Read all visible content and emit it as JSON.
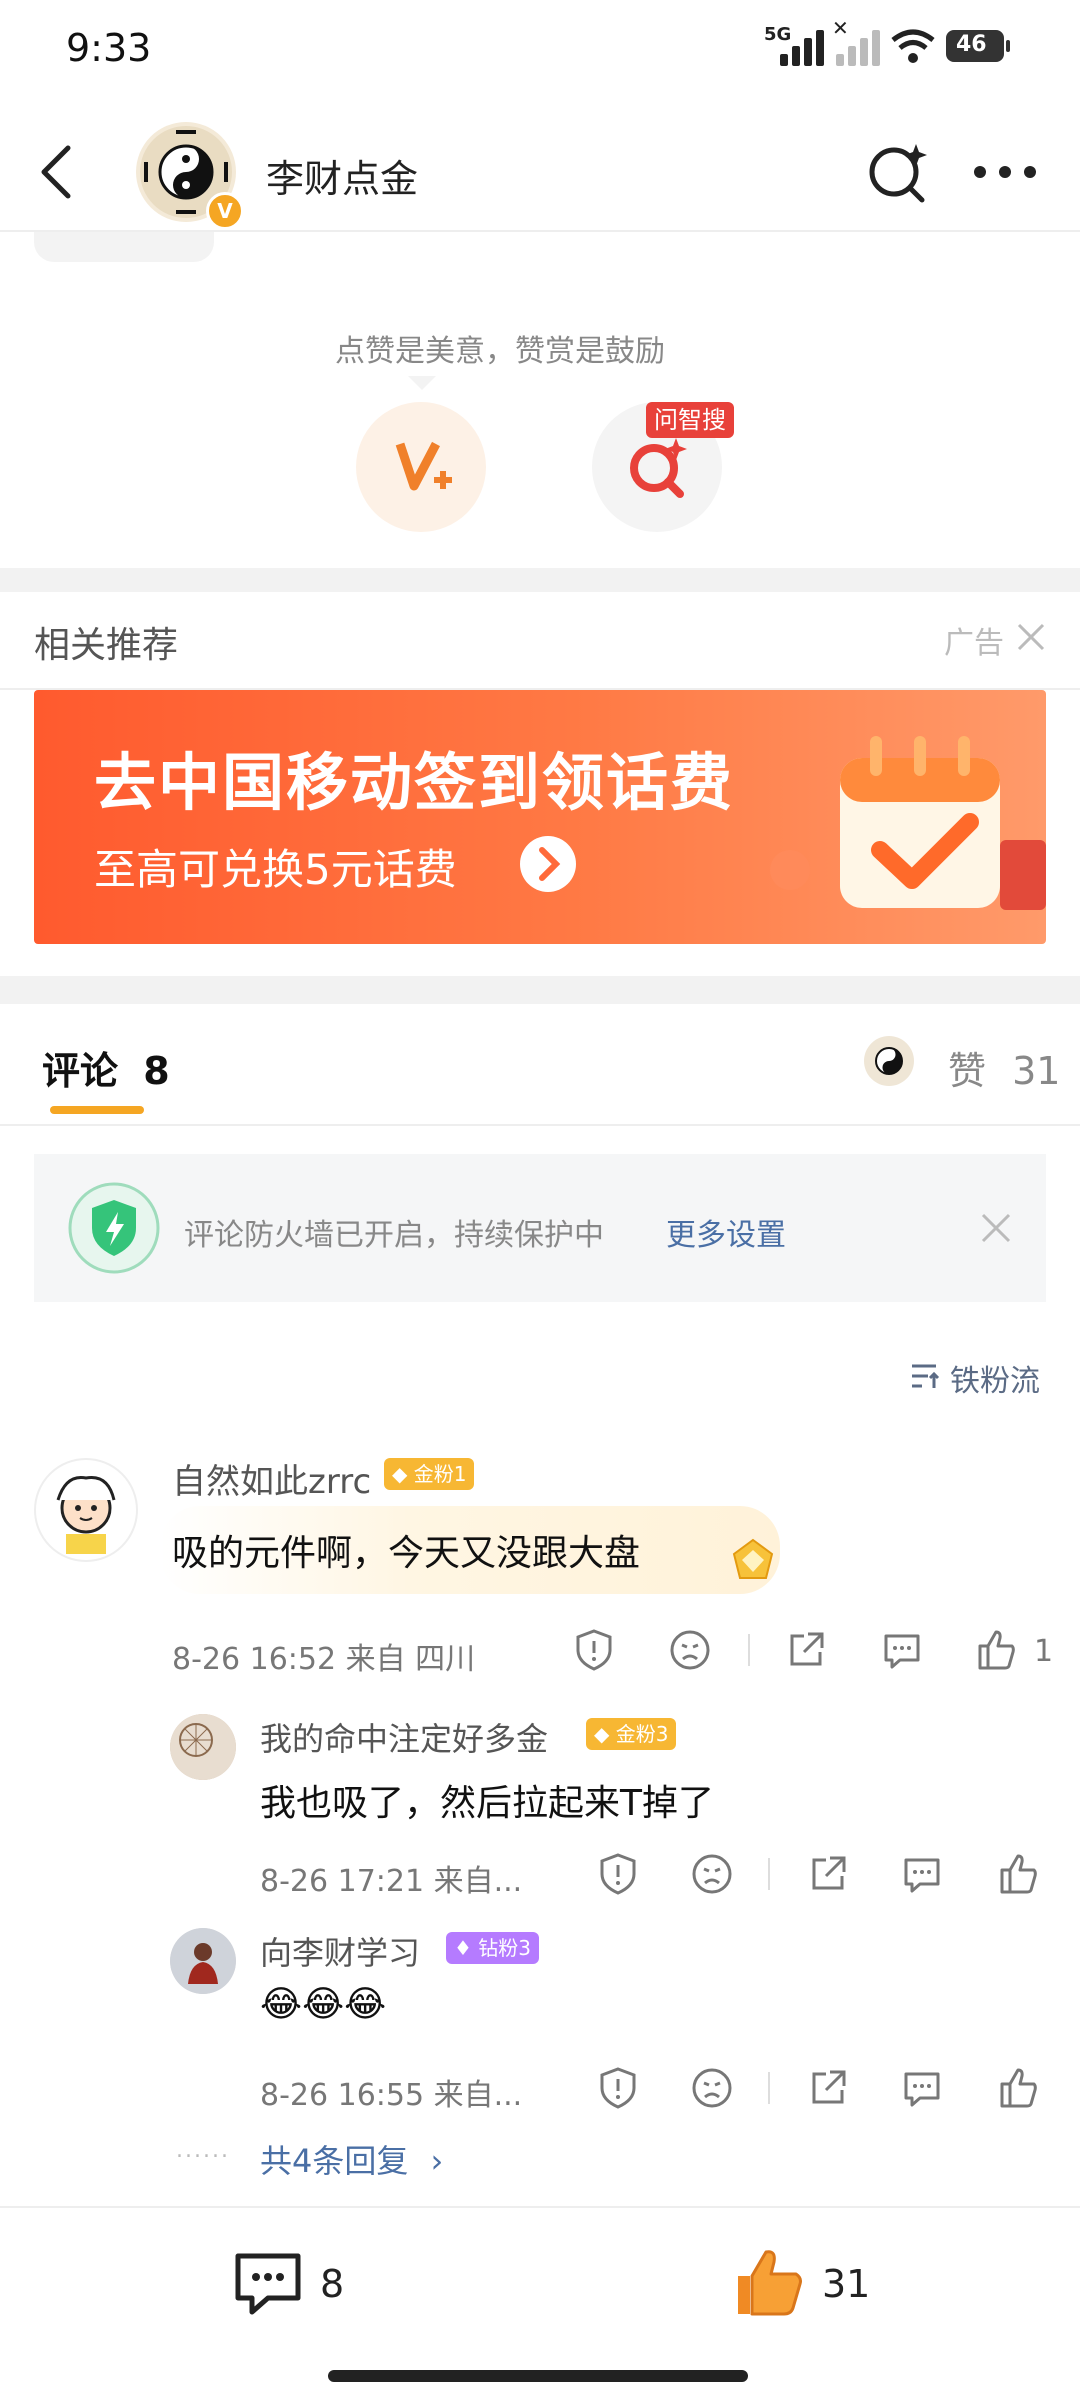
{
  "status": {
    "time": "9:33",
    "network": "5G",
    "battery": "46"
  },
  "header": {
    "back_icon": "chevron-left-icon",
    "title": "李财点金",
    "verified_badge": "V",
    "search_icon": "ai-search-icon",
    "more_icon": "more-dots-icon"
  },
  "reward": {
    "hint": "点赞是美意，赞赏是鼓励",
    "reward_icon": "v-plus-icon",
    "ask_badge": "问智搜"
  },
  "related": {
    "title": "相关推荐",
    "ad_label": "广告",
    "banner_line1": "去中国移动签到领话费",
    "banner_line2": "至高可兑换5元话费"
  },
  "comments_header": {
    "tab_label": "评论",
    "tab_count": "8",
    "likes_label": "赞",
    "likes_count": "31"
  },
  "firewall": {
    "text": "评论防火墙已开启，持续保护中",
    "link": "更多设置"
  },
  "sort": {
    "label": "铁粉流"
  },
  "comments": [
    {
      "user": "自然如此zrrc",
      "badge": "金粉1",
      "text": "吸的元件啊，今天又没跟大盘",
      "meta": "8-26 16:52  来自 四川",
      "like_count": "1"
    }
  ],
  "replies": [
    {
      "user": "我的命中注定好多金",
      "badge": "金粉3",
      "text": "我也吸了，然后拉起来T掉了",
      "meta": "8-26 17:21  来自..."
    },
    {
      "user": "向李财学习",
      "badge": "钻粉3",
      "text": "😂😂😂",
      "meta": "8-26 16:55  来自..."
    }
  ],
  "more_replies": {
    "dots": "......",
    "label": "共4条回复"
  },
  "bottom_bar": {
    "comment_count": "8",
    "like_count": "31"
  },
  "colors": {
    "accent_orange": "#f5a623",
    "link_blue": "#4a6fa5",
    "badge_gold": "#f7b733",
    "badge_purple": "#b57bff",
    "ask_red": "#e8413a"
  }
}
